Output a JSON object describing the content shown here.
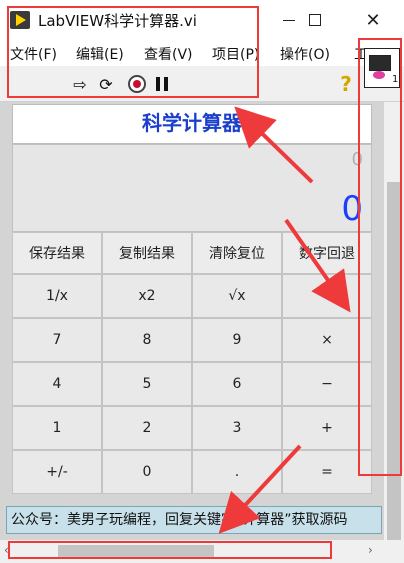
{
  "window": {
    "title": "LabVIEW科学计算器.vi"
  },
  "menu": [
    "文件(F)",
    "编辑(E)",
    "查看(V)",
    "项目(P)",
    "操作(O)",
    "工"
  ],
  "calculator": {
    "title": "科学计算器",
    "display_small": "0",
    "display_main": "0",
    "function_keys": [
      "保存结果",
      "复制结果",
      "清除复位",
      "数字回退"
    ],
    "keys": [
      "1/x",
      "x2",
      "√x",
      "÷",
      "7",
      "8",
      "9",
      "×",
      "4",
      "5",
      "6",
      "−",
      "1",
      "2",
      "3",
      "+",
      "+/-",
      "0",
      ".",
      "="
    ]
  },
  "footer": {
    "text": "公众号：美男子玩编程，回复关键字“计算器”获取源码"
  },
  "vi_icon_number": "1",
  "colors": {
    "title_blue": "#1a3fcc",
    "display_blue": "#1a3fff",
    "annotation_red": "#ee3a3a",
    "footer_bg": "#c8e0ea"
  }
}
